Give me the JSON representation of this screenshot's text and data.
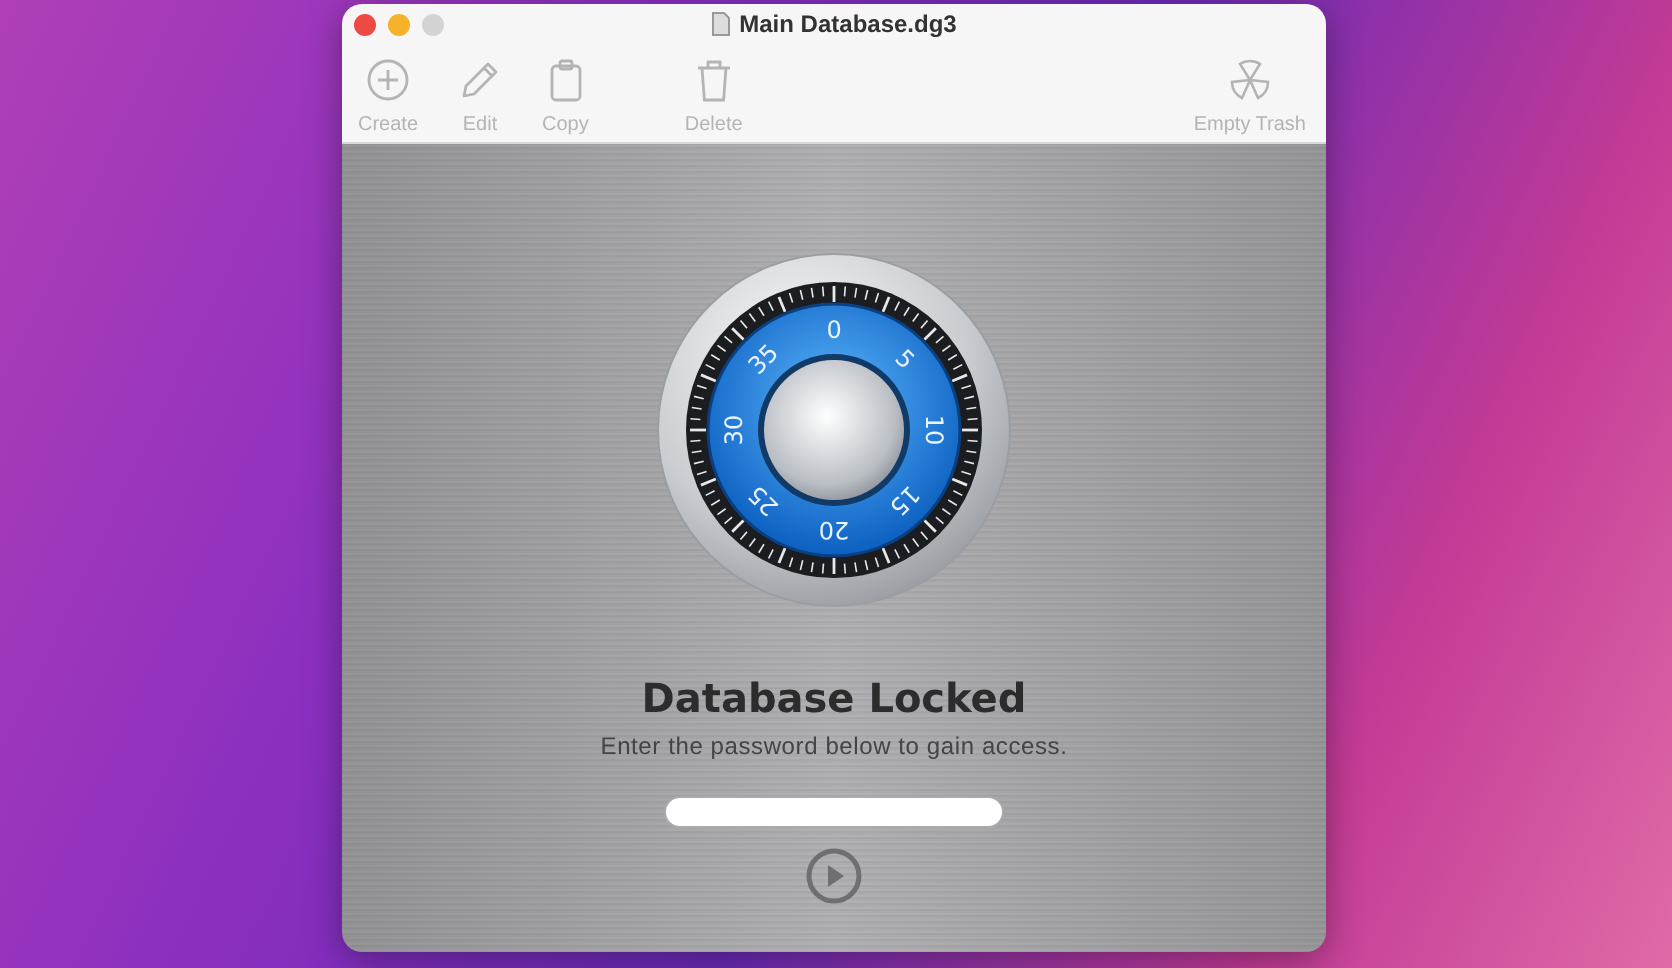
{
  "window": {
    "title": "Main Database.dg3"
  },
  "toolbar": {
    "items": [
      {
        "kind": "create",
        "label": "Create",
        "disabled": true
      },
      {
        "kind": "edit",
        "label": "Edit",
        "disabled": true
      },
      {
        "kind": "copy",
        "label": "Copy",
        "disabled": true
      },
      {
        "kind": "delete",
        "label": "Delete",
        "disabled": true
      },
      {
        "kind": "empty-trash",
        "label": "Empty Trash",
        "disabled": true
      }
    ]
  },
  "dial": {
    "numbers": [
      "0",
      "5",
      "10",
      "15",
      "20",
      "25",
      "30",
      "35"
    ]
  },
  "lock_screen": {
    "title": "Database Locked",
    "subtitle": "Enter the password below to gain access."
  }
}
